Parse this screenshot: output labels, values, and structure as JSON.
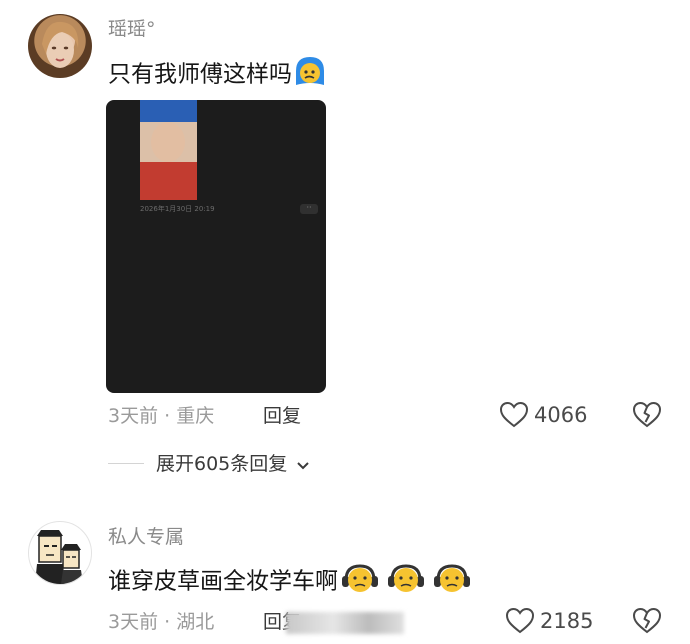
{
  "comments": [
    {
      "username": "瑶瑶°",
      "text": "只有我师傅这样吗",
      "image": {
        "timestamp": "2026年1月30日 20:19",
        "menu": "··"
      },
      "meta": "3天前 · 重庆",
      "reply_label": "回复",
      "likes": "4066",
      "expand_label": "展开605条回复"
    },
    {
      "username": "私人专属",
      "text": "谁穿皮草画全妆学车啊",
      "meta": "3天前 · 湖北",
      "reply_label": "回复",
      "likes": "2185"
    }
  ],
  "icons": {
    "like": "heart-outline-icon",
    "dislike": "broken-heart-icon",
    "expand": "chevron-down-icon"
  },
  "colors": {
    "emoji_yellow": "#F6C330",
    "emoji_blue": "#2E8BE6",
    "text_muted": "#9a9a9a"
  }
}
